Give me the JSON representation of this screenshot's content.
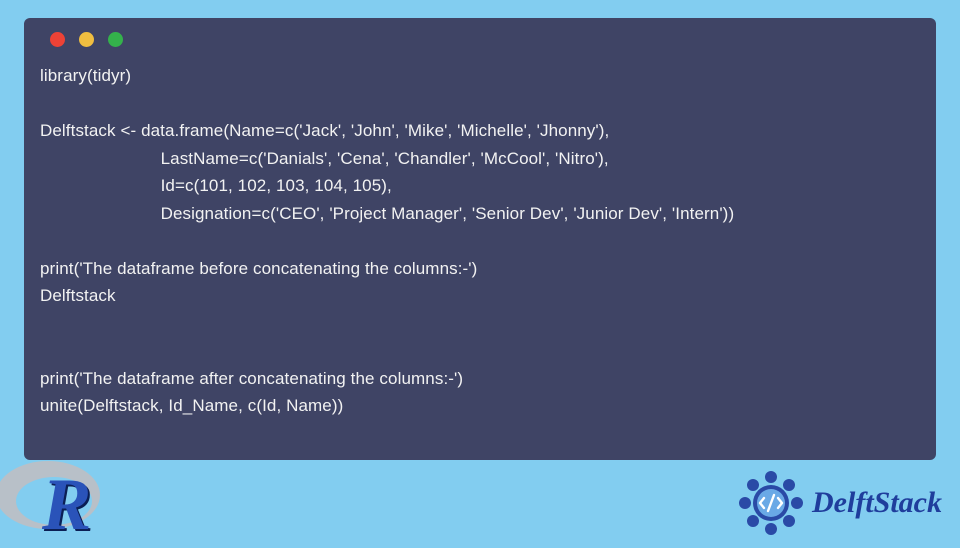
{
  "code": {
    "lines_text": "library(tidyr)\n\nDelftstack <- data.frame(Name=c('Jack', 'John', 'Mike', 'Michelle', 'Jhonny'),\n                         LastName=c('Danials', 'Cena', 'Chandler', 'McCool', 'Nitro'),\n                         Id=c(101, 102, 103, 104, 105),\n                         Designation=c('CEO', 'Project Manager', 'Senior Dev', 'Junior Dev', 'Intern'))\n\nprint('The dataframe before concatenating the columns:-')\nDelftstack\n\n\nprint('The dataframe after concatenating the columns:-')\nunite(Delftstack, Id_Name, c(Id, Name))"
  },
  "titlebar": {
    "dots": [
      "red",
      "yellow",
      "green"
    ]
  },
  "brand": {
    "name": "DelftStack"
  },
  "colors": {
    "page_bg": "#82cdf0",
    "window_bg": "#3f4465",
    "brand_blue": "#1f3d9c"
  }
}
